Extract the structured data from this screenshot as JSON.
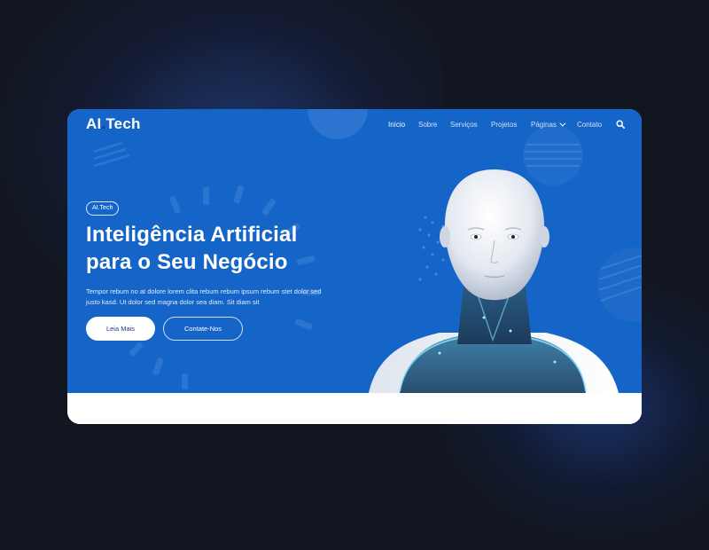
{
  "brand": {
    "logo_main": "AI",
    "logo_dot": ".",
    "logo_rest": "Tech"
  },
  "nav": {
    "items": [
      {
        "label": "Início",
        "active": true
      },
      {
        "label": "Sobre"
      },
      {
        "label": "Serviços"
      },
      {
        "label": "Projetos"
      },
      {
        "label": "Páginas",
        "has_dropdown": true
      },
      {
        "label": "Contato"
      }
    ],
    "search_icon": "search-icon"
  },
  "hero": {
    "badge": "AI.Tech",
    "title_line1": "Inteligência Artificial",
    "title_line2": "para o Seu Negócio",
    "description_line1": "Tempor rebum no at dolore lorem clita rebum rebum ipsum rebum stet dolor sed",
    "description_line2": "justo kasd. Ut dolor sed magna dolor sea diam. Sit diam sit",
    "primary_button": "Leia Mais",
    "secondary_button": "Contate-Nos",
    "image": "humanoid-robot"
  },
  "colors": {
    "page_background": "#121620",
    "hero_background": "#1565c8",
    "accent_dark": "#0b3a8a",
    "text_light": "#ffffff"
  }
}
